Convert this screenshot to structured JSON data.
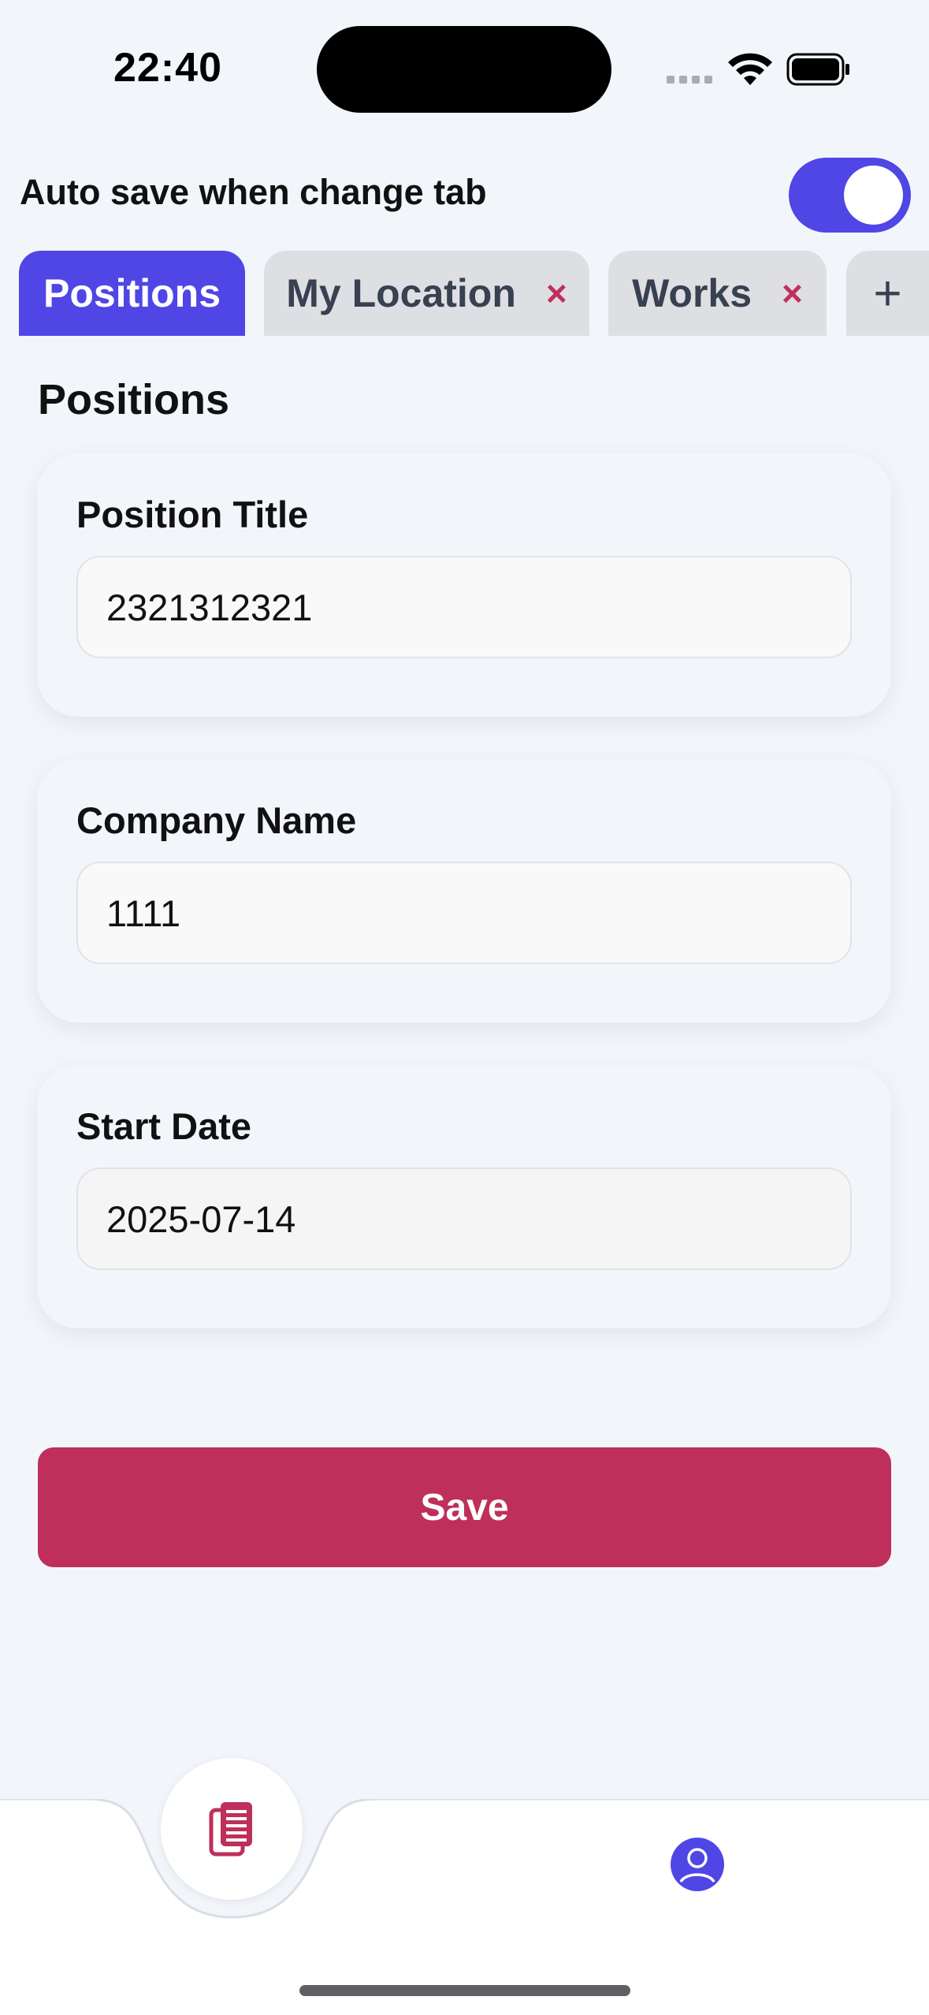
{
  "status_bar": {
    "time": "22:40"
  },
  "settings": {
    "auto_save_label": "Auto save when change tab",
    "auto_save_enabled": true
  },
  "tabs": [
    {
      "label": "Positions",
      "active": true,
      "closable": false
    },
    {
      "label": "My Location",
      "active": false,
      "closable": true,
      "close_icon": "×"
    },
    {
      "label": "Works",
      "active": false,
      "closable": true,
      "close_icon": "×"
    }
  ],
  "add_tab_label": "+",
  "section": {
    "title": "Positions"
  },
  "form": {
    "position_title": {
      "label": "Position Title",
      "value": "2321312321"
    },
    "company_name": {
      "label": "Company Name",
      "value": "1111"
    },
    "start_date": {
      "label": "Start Date",
      "value": "2025-07-14"
    }
  },
  "save_label": "Save",
  "nav": {
    "items": [
      "documents-icon",
      "profile-icon"
    ]
  },
  "colors": {
    "accent": "#4F46E5",
    "save_button": "#BE2F5C",
    "close_icon": "#C0305F",
    "background": "#F2F6FA"
  }
}
